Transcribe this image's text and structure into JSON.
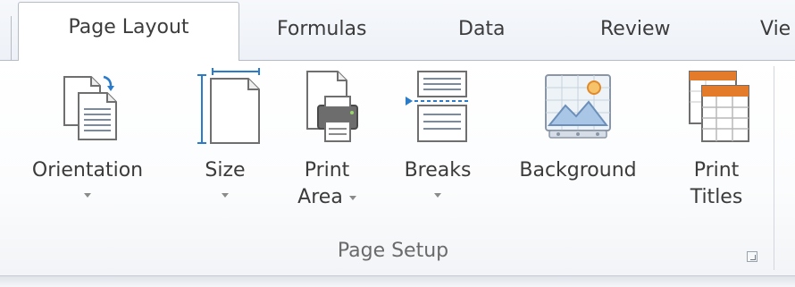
{
  "tabs": [
    {
      "label": "Page Layout",
      "active": true
    },
    {
      "label": "Formulas"
    },
    {
      "label": "Data"
    },
    {
      "label": "Review"
    },
    {
      "label": "Vie"
    }
  ],
  "group": {
    "label": "Page Setup",
    "buttons": [
      {
        "id": "orientation",
        "line1": "Orientation",
        "line2": "",
        "dropdown": true,
        "icon": "orientation-icon"
      },
      {
        "id": "size",
        "line1": "Size",
        "line2": "",
        "dropdown": true,
        "icon": "size-icon"
      },
      {
        "id": "print-area",
        "line1": "Print",
        "line2": "Area",
        "dropdown": true,
        "icon": "print-area-icon"
      },
      {
        "id": "breaks",
        "line1": "Breaks",
        "line2": "",
        "dropdown": true,
        "icon": "breaks-icon"
      },
      {
        "id": "background",
        "line1": "Background",
        "line2": "",
        "dropdown": false,
        "icon": "background-icon"
      },
      {
        "id": "print-titles",
        "line1": "Print",
        "line2": "Titles",
        "dropdown": false,
        "icon": "print-titles-icon"
      }
    ]
  },
  "colors": {
    "accent_blue": "#2a7bc9",
    "orange": "#e37b2a",
    "border": "#b6bcc6"
  }
}
